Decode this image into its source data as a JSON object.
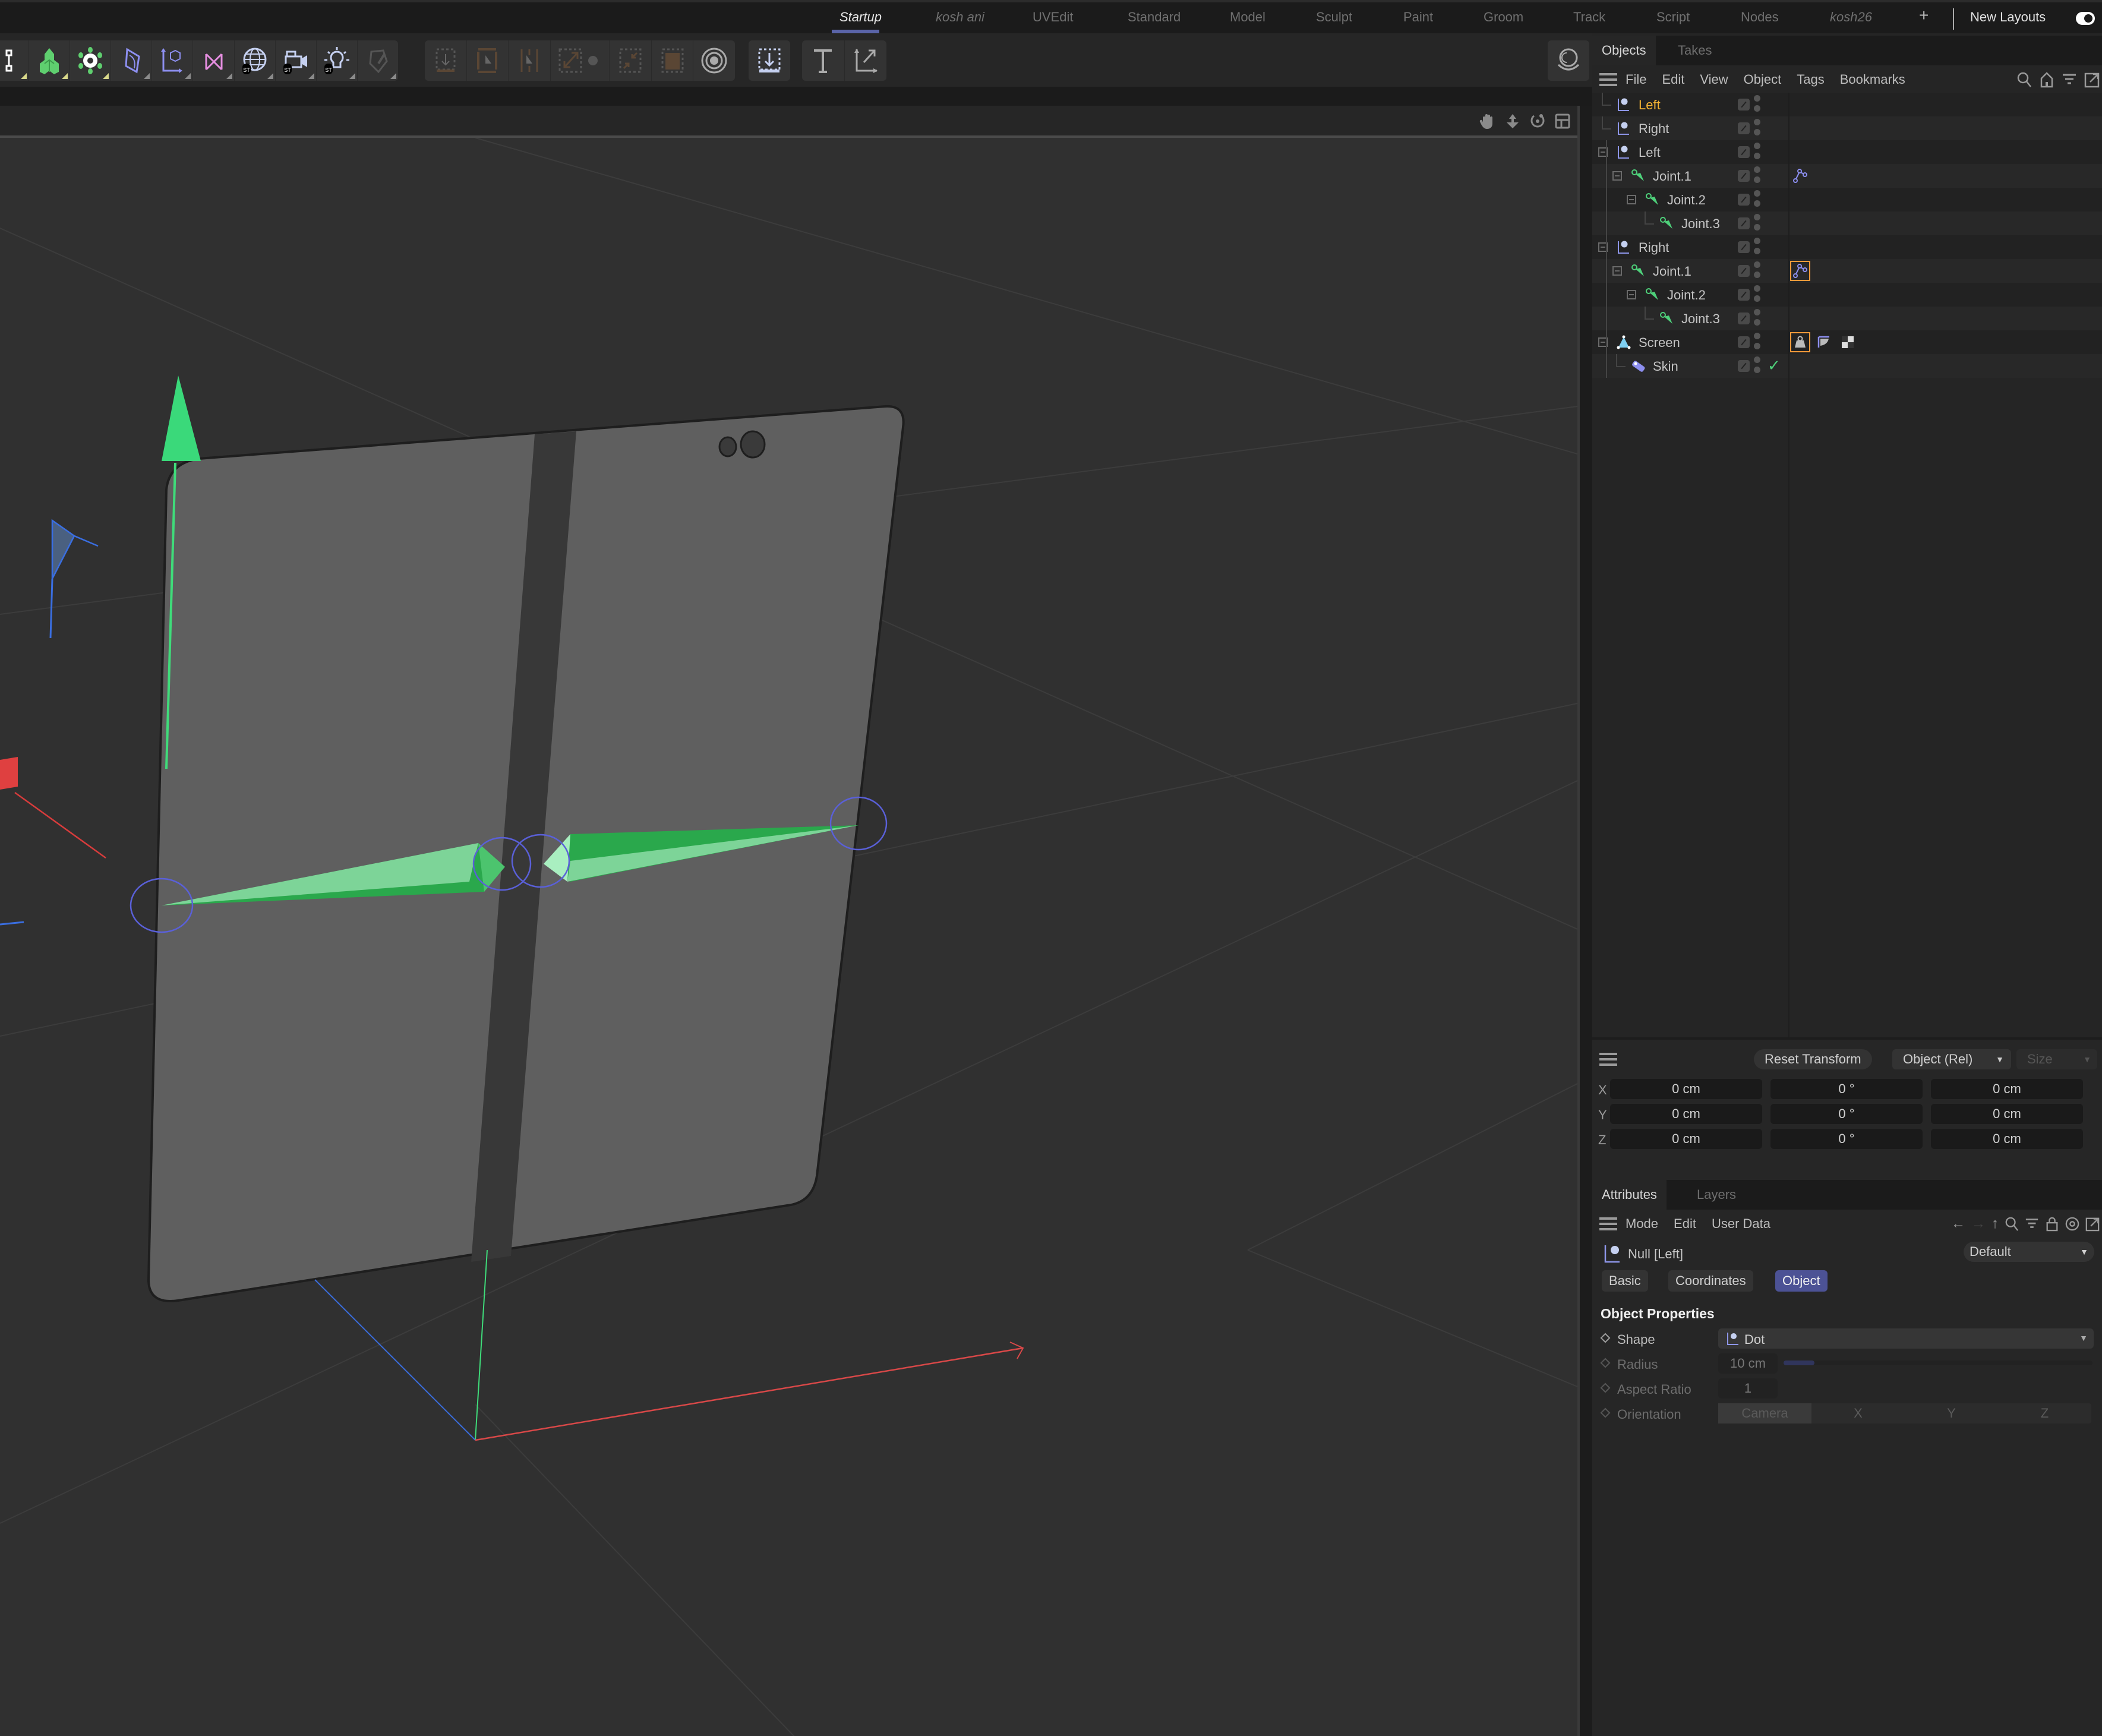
{
  "layout_tabs": {
    "items": [
      {
        "label": "Startup",
        "active": true,
        "italic": true
      },
      {
        "label": "kosh ani",
        "italic": true
      },
      {
        "label": "UVEdit"
      },
      {
        "label": "Standard"
      },
      {
        "label": "Model"
      },
      {
        "label": "Sculpt"
      },
      {
        "label": "Paint"
      },
      {
        "label": "Groom"
      },
      {
        "label": "Track"
      },
      {
        "label": "Script"
      },
      {
        "label": "Nodes"
      },
      {
        "label": "kosh26",
        "italic": true
      }
    ],
    "add_label": "+",
    "new_layouts_label": "New Layouts"
  },
  "toolbar": {
    "group1": [
      "spline-tools-icon",
      "generators-icon",
      "deformers-icon",
      "fields-icon",
      "null-object-icon",
      "mograph-icon",
      "environment-icon",
      "camera-icon",
      "light-icon",
      "paint-tool-icon"
    ],
    "group2": [
      "bake-icon",
      "render-region-icon",
      "render-active-icon",
      "scale-icon",
      "settings-icon",
      "shrink-icon",
      "render-fill-icon",
      "target-icon"
    ],
    "group3": [
      "import-icon"
    ],
    "group4": [
      "text-tool-icon",
      "axis-tool-icon"
    ],
    "global_tool": "orbit-icon"
  },
  "objects_panel": {
    "tabs": [
      "Objects",
      "Takes"
    ],
    "menu": [
      "File",
      "Edit",
      "View",
      "Object",
      "Tags",
      "Bookmarks"
    ],
    "tree": [
      {
        "label": "Left",
        "icon": "null-icon",
        "depth": 0,
        "selected": true,
        "collapsible": false
      },
      {
        "label": "Right",
        "icon": "null-icon",
        "depth": 0,
        "collapsible": false
      },
      {
        "label": "Left",
        "icon": "null-icon",
        "depth": 0,
        "collapsible": true
      },
      {
        "label": "Joint.1",
        "icon": "joint-icon",
        "depth": 1,
        "collapsible": true,
        "tags": [
          {
            "icon": "ik-tag-icon"
          }
        ]
      },
      {
        "label": "Joint.2",
        "icon": "joint-icon",
        "depth": 2,
        "collapsible": true
      },
      {
        "label": "Joint.3",
        "icon": "joint-icon",
        "depth": 3,
        "collapsible": false
      },
      {
        "label": "Right",
        "icon": "null-icon",
        "depth": 0,
        "collapsible": true
      },
      {
        "label": "Joint.1",
        "icon": "joint-icon",
        "depth": 1,
        "collapsible": true,
        "tags": [
          {
            "icon": "ik-tag-icon",
            "selected": true
          }
        ]
      },
      {
        "label": "Joint.2",
        "icon": "joint-icon",
        "depth": 2,
        "collapsible": true
      },
      {
        "label": "Joint.3",
        "icon": "joint-icon",
        "depth": 3,
        "collapsible": false
      },
      {
        "label": "Screen",
        "icon": "polygon-icon",
        "depth": 0,
        "collapsible": true,
        "tags": [
          {
            "icon": "weight-tag-icon",
            "selected": true
          },
          {
            "icon": "phong-tag-icon"
          },
          {
            "icon": "material-tag-icon"
          }
        ]
      },
      {
        "label": "Skin",
        "icon": "skin-icon",
        "depth": 1,
        "collapsible": false,
        "enabled_check": true
      }
    ]
  },
  "coordinates": {
    "reset_label": "Reset Transform",
    "mode_select": "Object (Rel)",
    "size_select": "Size",
    "rows": [
      {
        "axis": "X",
        "pos": "0 cm",
        "rot": "0 °",
        "scale": "0 cm"
      },
      {
        "axis": "Y",
        "pos": "0 cm",
        "rot": "0 °",
        "scale": "0 cm"
      },
      {
        "axis": "Z",
        "pos": "0 cm",
        "rot": "0 °",
        "scale": "0 cm"
      }
    ]
  },
  "attributes": {
    "tabs": [
      "Attributes",
      "Layers"
    ],
    "menu": [
      "Mode",
      "Edit",
      "User Data"
    ],
    "object_title": "Null [Left]",
    "preset": "Default",
    "subtabs": [
      {
        "label": "Basic"
      },
      {
        "label": "Coordinates"
      },
      {
        "label": "Object",
        "active": true
      }
    ],
    "section_title": "Object Properties",
    "shape_label": "Shape",
    "shape_value": "Dot",
    "radius_label": "Radius",
    "radius_value": "10 cm",
    "radius_slider_fraction": 0.1,
    "aspect_label": "Aspect Ratio",
    "aspect_value": "1",
    "orientation_label": "Orientation",
    "orientation_options": [
      "Camera",
      "X",
      "Y",
      "Z"
    ],
    "orientation_selected": "Camera"
  },
  "colors": {
    "accent": "#5a64a8",
    "selected_object": "#f2b233",
    "joint_green": "#4ed07a",
    "tag_highlight": "#f39a3a",
    "active_subtab": "#4c5295"
  }
}
